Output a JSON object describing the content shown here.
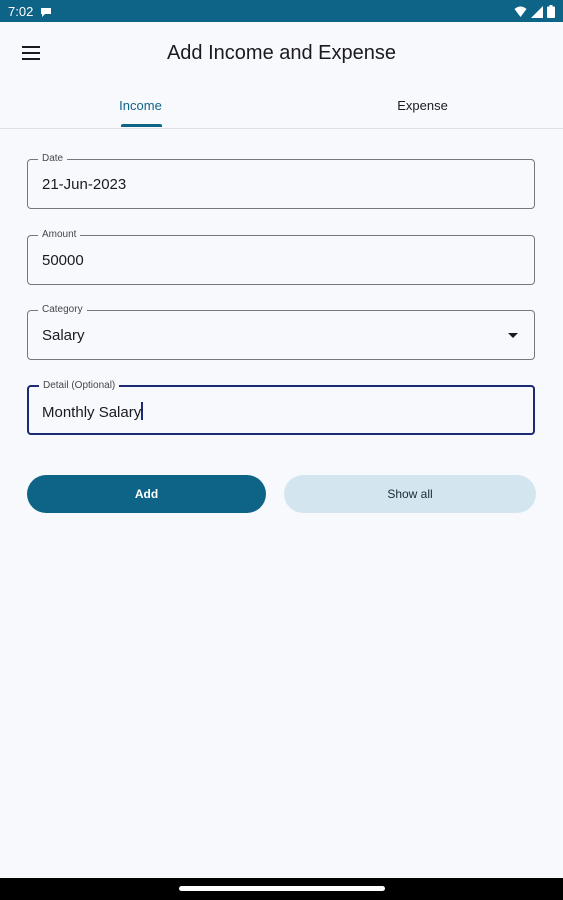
{
  "status_bar": {
    "time": "7:02",
    "notification_icon": "message-icon",
    "icons": [
      "wifi-icon",
      "signal-icon",
      "battery-icon"
    ]
  },
  "app_bar": {
    "menu_icon": "hamburger-menu-icon",
    "title": "Add Income and Expense"
  },
  "tabs": [
    {
      "label": "Income",
      "selected": true
    },
    {
      "label": "Expense",
      "selected": false
    }
  ],
  "form": {
    "date": {
      "label": "Date",
      "value": "21-Jun-2023"
    },
    "amount": {
      "label": "Amount",
      "value": "50000"
    },
    "category": {
      "label": "Category",
      "value": "Salary"
    },
    "detail": {
      "label": "Detail (Optional)",
      "value": "Monthly Salary"
    }
  },
  "buttons": {
    "add": "Add",
    "show_all": "Show all"
  },
  "colors": {
    "primary": "#0e6486",
    "focus": "#1c2a73",
    "secondary_container": "#d3e6ef",
    "background": "#f8f9fd"
  }
}
